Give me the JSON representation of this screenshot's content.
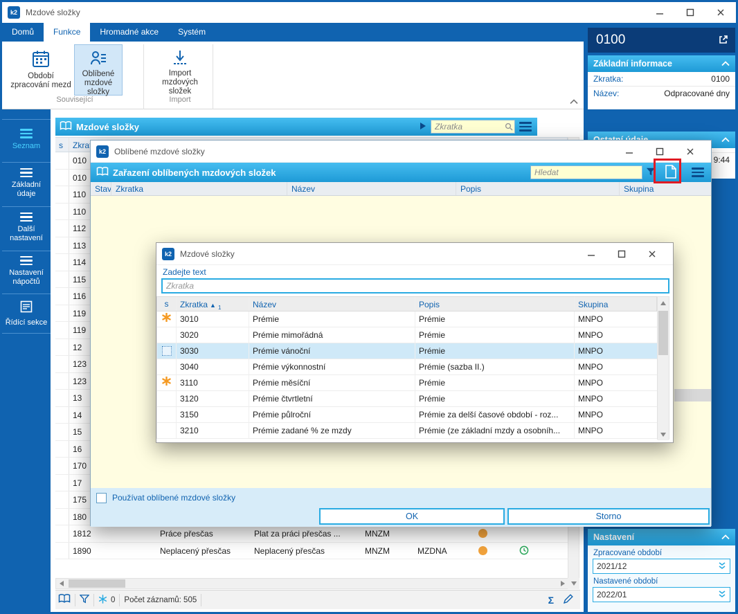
{
  "logo_text": "k2",
  "icons": {
    "sigma": "Σ",
    "sort_asc": "▲"
  },
  "colors": {
    "primary_blue": "#1063b0",
    "dark_blue": "#0b3c78",
    "cyan": "#29abe2",
    "cream": "#fffde1",
    "search_yellow": "#ffffd2",
    "row_highlight": "#cfe9f8",
    "strip_blue": "#d7ecf9",
    "favorite_orange": "#f59a23",
    "dot_orange": "#f2a33c",
    "annotation_red": "#e01b24"
  },
  "main_window": {
    "title": "Mzdové složky",
    "ribbon": {
      "tabs": [
        {
          "label": "Domů",
          "active": false
        },
        {
          "label": "Funkce",
          "active": true
        },
        {
          "label": "Hromadné akce",
          "active": false
        },
        {
          "label": "Systém",
          "active": false
        }
      ],
      "buttons": [
        {
          "label": "Období zpracování mezd",
          "active": false
        },
        {
          "label": "Oblíbené mzdové složky",
          "active": true
        },
        {
          "label": "Import mzdových složek",
          "active": false
        }
      ],
      "group_labels": [
        "Související",
        "Import"
      ]
    },
    "sidebar": {
      "items": [
        {
          "label": "Seznam",
          "active": true
        },
        {
          "label": "Základní údaje",
          "active": false
        },
        {
          "label": "Další nastavení",
          "active": false
        },
        {
          "label": "Nastavení nápočtů",
          "active": false
        },
        {
          "label": "Řídící sekce",
          "active": false
        }
      ]
    },
    "content": {
      "panel_title": "Mzdové složky",
      "search_placeholder": "Zkratka",
      "table": {
        "col_s": "s",
        "col_zkratka": "Zkratka",
        "partial_rows": [
          "010",
          "010",
          "110",
          "110",
          "112",
          "113",
          "114",
          "115",
          "116",
          "119",
          "119",
          "12",
          "123",
          "123",
          "13",
          "14",
          "15",
          "16",
          "170",
          "17",
          "175",
          "180"
        ],
        "rows": [
          {
            "zkratka": "1812",
            "nazev": "Práce přesčas",
            "popis": "Plat za práci přesčas ...",
            "sk1": "MNZM",
            "sk2": "",
            "dot": true,
            "clock": false
          },
          {
            "zkratka": "1890",
            "nazev": "Neplacený přesčas",
            "popis": "Neplacený přesčas",
            "sk1": "MNZM",
            "sk2": "MZDNA",
            "dot": true,
            "clock": true
          }
        ]
      },
      "status_bar": {
        "freeze_count": "0",
        "record_count": "Počet záznamů: 505"
      }
    },
    "right_panel": {
      "record_id": "0100",
      "basic_info": {
        "title": "Základní informace",
        "rows": [
          {
            "label": "Zkratka:",
            "value": "0100"
          },
          {
            "label": "Název:",
            "value": "Odpracované dny"
          }
        ]
      },
      "other_info": {
        "title": "Ostatní údaje",
        "visible_value": "9:44"
      },
      "settings": {
        "title": "Nastavení",
        "fields": [
          {
            "label": "Zpracované období",
            "value": "2021/12"
          },
          {
            "label": "Nastavené období",
            "value": "2022/01"
          }
        ]
      }
    }
  },
  "dialog_favorites": {
    "title": "Oblíbené mzdové složky",
    "panel_title": "Zařazení oblíbených mzdových složek",
    "search_placeholder": "Hledat",
    "columns": [
      "Stav",
      "Zkratka",
      "Název",
      "Popis",
      "Skupina"
    ],
    "checkbox_label": "Používat oblíbené mzdové složky",
    "ok_label": "OK",
    "cancel_label": "Storno"
  },
  "dialog_picker": {
    "title": "Mzdové složky",
    "prompt": "Zadejte text",
    "input_placeholder": "Zkratka",
    "columns": [
      "s",
      "Zkratka",
      "Název",
      "Popis",
      "Skupina"
    ],
    "sort_number": "1",
    "rows": [
      {
        "fav": true,
        "selected": false,
        "zkratka": "3010",
        "nazev": "Prémie",
        "popis": "Prémie",
        "skupina": "MNPO"
      },
      {
        "fav": false,
        "selected": false,
        "zkratka": "3020",
        "nazev": "Prémie mimořádná",
        "popis": "Prémie",
        "skupina": "MNPO"
      },
      {
        "fav": false,
        "selected": true,
        "zkratka": "3030",
        "nazev": "Prémie vánoční",
        "popis": "Prémie",
        "skupina": "MNPO"
      },
      {
        "fav": false,
        "selected": false,
        "zkratka": "3040",
        "nazev": "Prémie výkonnostní",
        "popis": "Prémie (sazba II.)",
        "skupina": "MNPO"
      },
      {
        "fav": true,
        "selected": false,
        "zkratka": "3110",
        "nazev": "Prémie měsíční",
        "popis": "Prémie",
        "skupina": "MNPO"
      },
      {
        "fav": false,
        "selected": false,
        "zkratka": "3120",
        "nazev": "Prémie čtvrtletní",
        "popis": "Prémie",
        "skupina": "MNPO"
      },
      {
        "fav": false,
        "selected": false,
        "zkratka": "3150",
        "nazev": "Prémie půlroční",
        "popis": "Prémie za delší časové období - roz...",
        "skupina": "MNPO"
      },
      {
        "fav": false,
        "selected": false,
        "zkratka": "3210",
        "nazev": "Prémie zadané % ze mzdy",
        "popis": "Prémie (ze základní mzdy a osobníh...",
        "skupina": "MNPO"
      }
    ]
  }
}
